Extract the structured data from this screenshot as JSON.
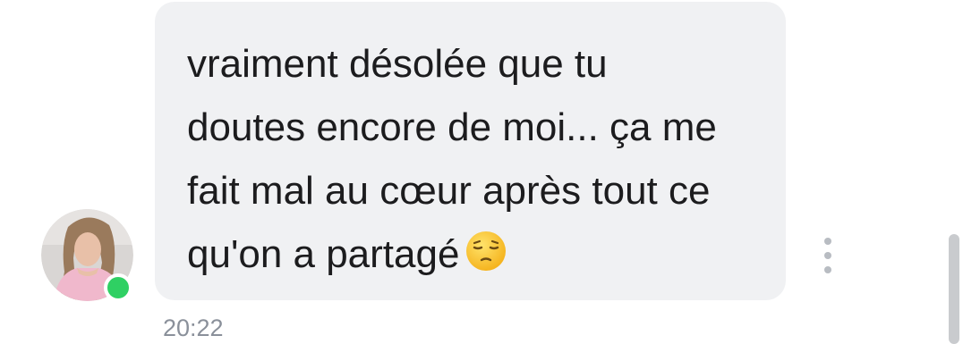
{
  "message": {
    "text": "vraiment désolée que tu\ndoutes encore de moi... ça me\nfait mal au cœur après tout ce\nqu'on a partagé",
    "emoji": "pensive-face",
    "timestamp": "20:22"
  },
  "sender": {
    "status": "online",
    "status_color": "#2fd063"
  },
  "colors": {
    "bubble_background": "#f0f1f3",
    "text": "#1c1c1e",
    "timestamp": "#8a909a"
  }
}
